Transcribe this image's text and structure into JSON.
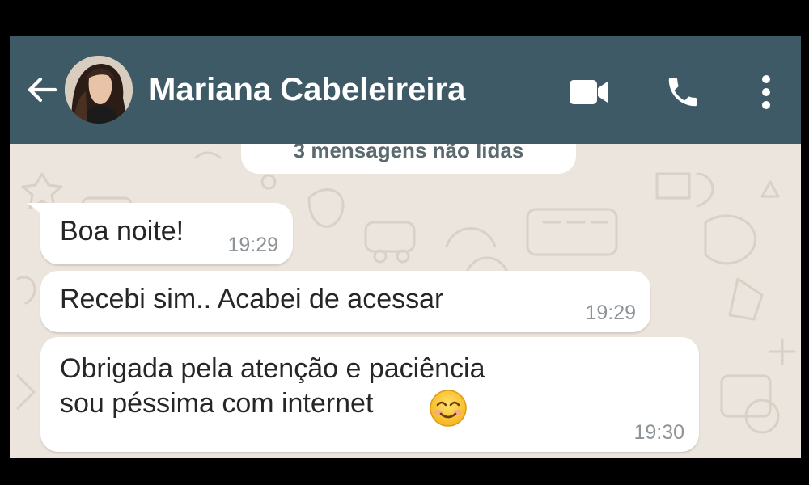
{
  "header": {
    "contact_name": "Mariana Cabeleireira",
    "background_color": "#3d5a66",
    "icons": [
      "back-arrow-icon",
      "avatar-photo",
      "video-call-icon",
      "phone-icon",
      "more-vert-icon"
    ]
  },
  "unread_banner": {
    "text": "3 mensagens não lidas"
  },
  "messages": [
    {
      "text": "Boa noite!",
      "time": "19:29"
    },
    {
      "text": "Recebi sim.. Acabei de acessar",
      "time": "19:29"
    },
    {
      "text": "Obrigada pela atenção e paciência\nsou péssima com internet",
      "time": "19:30",
      "emoji": "smiling-face-with-smiling-eyes"
    }
  ],
  "colors": {
    "chat_background": "#ece5dd",
    "bubble": "#ffffff",
    "text": "#262626",
    "timestamp": "#8d9396"
  }
}
